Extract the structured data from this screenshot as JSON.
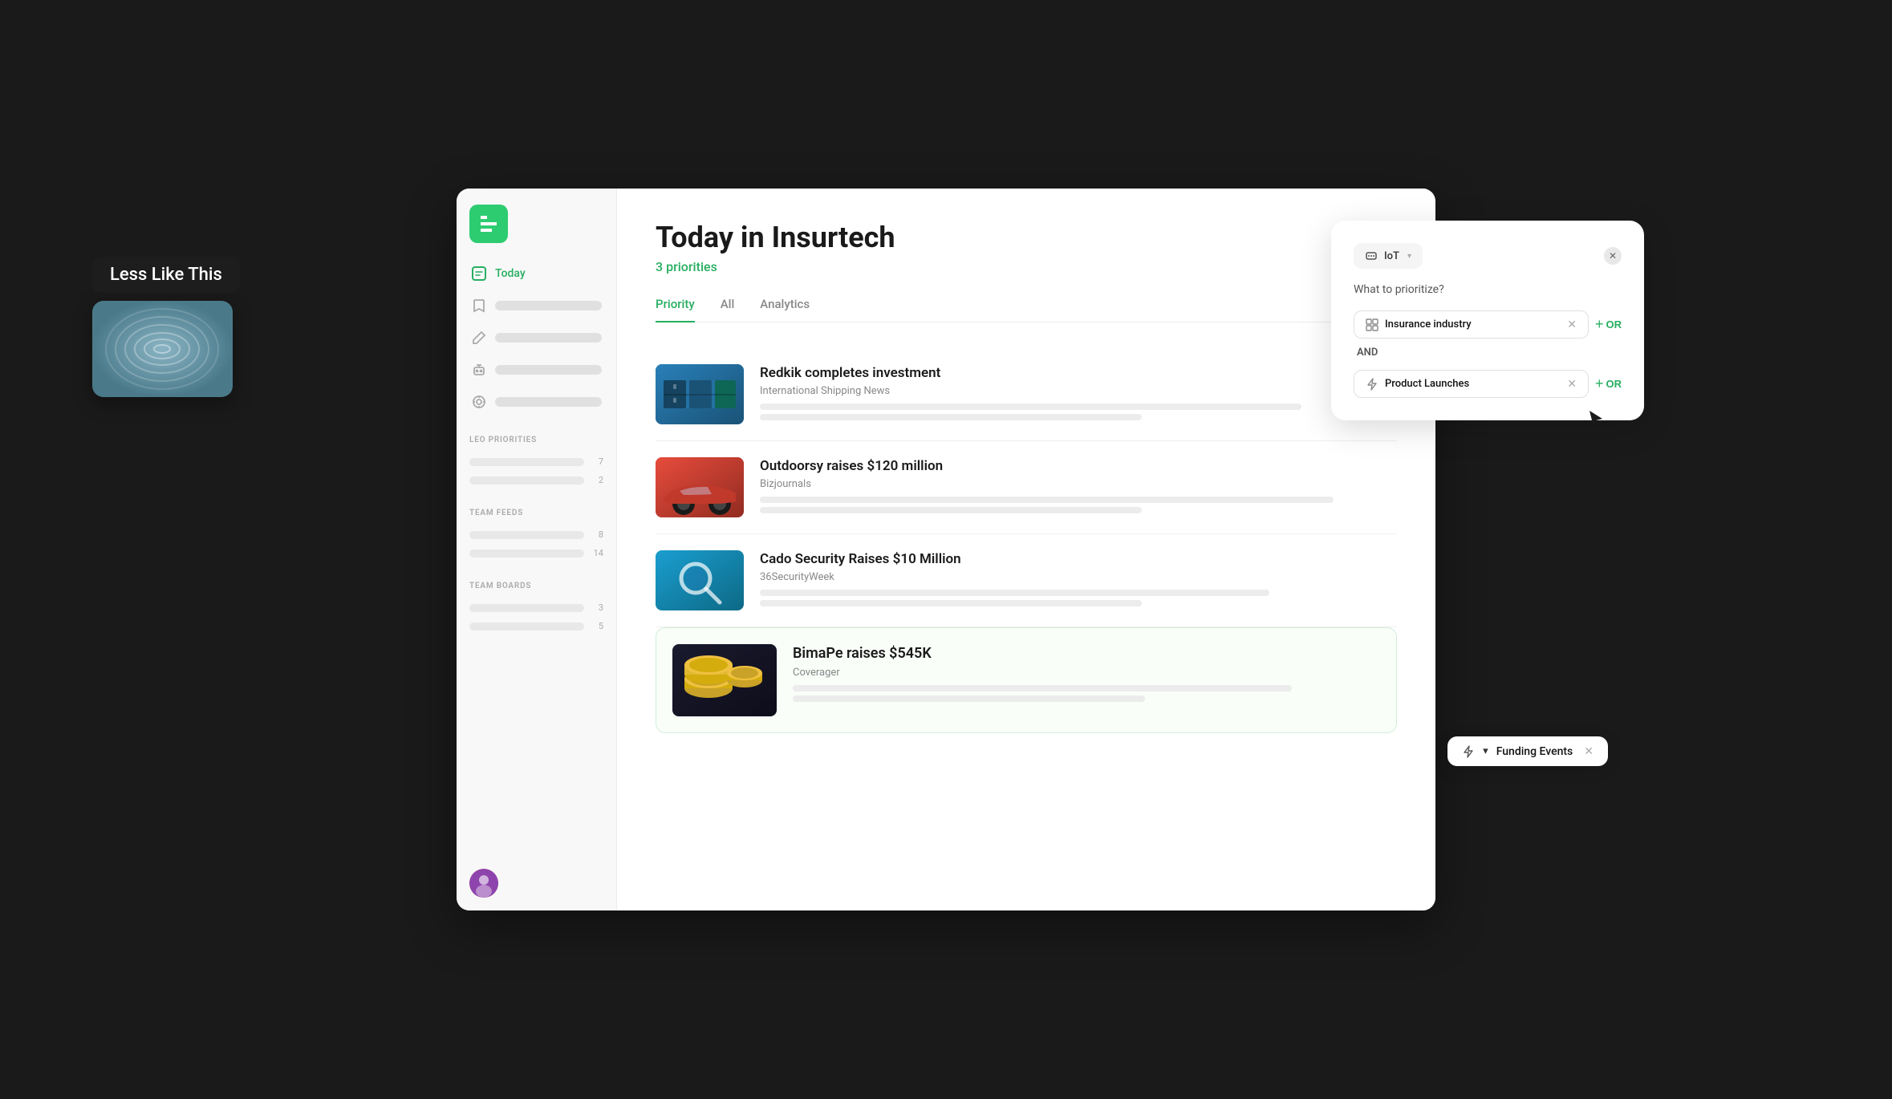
{
  "app": {
    "logo_label": "Feedly Logo",
    "window_title": "Today in Insurtech"
  },
  "sidebar": {
    "nav": {
      "today_label": "Today",
      "today_active": true
    },
    "sections": {
      "leo_priorities": {
        "title": "LEO PRIORITIES",
        "items": [
          {
            "skeleton_width": "70%",
            "count": "7"
          },
          {
            "skeleton_width": "55%",
            "count": "2"
          }
        ]
      },
      "team_feeds": {
        "title": "TEAM FEEDS",
        "items": [
          {
            "skeleton_width": "80%",
            "count": "8"
          },
          {
            "skeleton_width": "65%",
            "count": "14"
          }
        ]
      },
      "team_boards": {
        "title": "TEAM BOARDS",
        "items": [
          {
            "skeleton_width": "75%",
            "count": "3"
          },
          {
            "skeleton_width": "60%",
            "count": "5"
          }
        ]
      }
    }
  },
  "main": {
    "title": "Today in Insurtech",
    "subtitle": "3 priorities",
    "tabs": [
      {
        "label": "Priority",
        "active": true
      },
      {
        "label": "All",
        "active": false
      },
      {
        "label": "Analytics",
        "active": false
      }
    ],
    "articles": [
      {
        "id": "art1",
        "title": "Redkik completes investment",
        "source": "International Shipping News",
        "thumb_type": "shipping"
      },
      {
        "id": "art2",
        "title": "Outdoorsy raises $120 million",
        "source": "Bizjournals",
        "thumb_type": "car"
      },
      {
        "id": "art3",
        "title": "Cado Security Raises $10 Million",
        "source": "36SecurityWeek",
        "thumb_type": "security"
      },
      {
        "id": "art4",
        "title": "BimaPe raises $545K",
        "source": "Coverager",
        "thumb_type": "coins",
        "highlighted": true
      }
    ]
  },
  "filter_card": {
    "badge_label": "IoT",
    "question": "What to prioritize?",
    "tag1_label": "Insurance industry",
    "tag1_icon": "layout-icon",
    "and_label": "AND",
    "tag2_label": "Product Launches",
    "tag2_icon": "bolt-icon",
    "or_label": "OR",
    "add_label": "+ OR"
  },
  "funding_tag": {
    "label": "Funding Events",
    "icon": "bolt-icon"
  },
  "tooltip": {
    "less_like_this": "Less Like This"
  },
  "floating_card": {
    "description": "Fingerprint image thumbnail"
  }
}
